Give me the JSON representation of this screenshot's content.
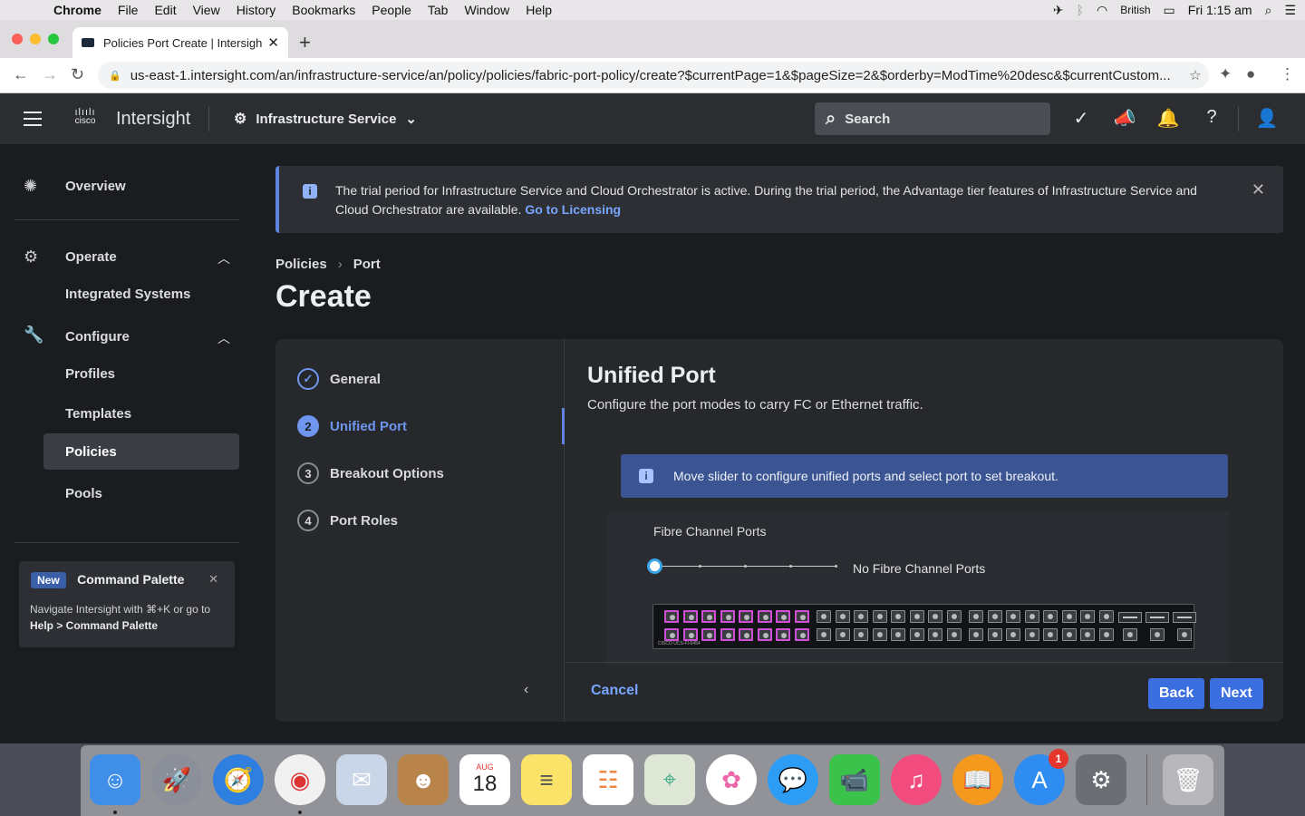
{
  "macos_menubar": {
    "app": "Chrome",
    "items": [
      "File",
      "Edit",
      "View",
      "History",
      "Bookmarks",
      "People",
      "Tab",
      "Window",
      "Help"
    ],
    "input_source": "British",
    "clock": "Fri 1:15 am"
  },
  "browser": {
    "tab_title": "Policies Port Create | Intersight",
    "url": "us-east-1.intersight.com/an/infrastructure-service/an/policy/policies/fabric-port-policy/create?$currentPage=1&$pageSize=2&$orderby=ModTime%20desc&$currentCustom..."
  },
  "header": {
    "brand_small": "cisco",
    "brand": "Intersight",
    "service": "Infrastructure Service",
    "search_placeholder": "Search"
  },
  "sidebar": {
    "overview": "Overview",
    "operate": "Operate",
    "integrated_systems": "Integrated Systems",
    "configure": "Configure",
    "profiles": "Profiles",
    "templates": "Templates",
    "policies": "Policies",
    "pools": "Pools",
    "palette": {
      "badge": "New",
      "title": "Command Palette",
      "desc_prefix": "Navigate Intersight with ⌘+K or go to ",
      "desc_link": "Help > Command Palette"
    }
  },
  "banner": {
    "text": "The trial period for Infrastructure Service and Cloud Orchestrator is active. During the trial period, the Advantage tier features of Infrastructure Service and Cloud Orchestrator are available.",
    "link": "Go to Licensing"
  },
  "breadcrumb": {
    "first": "Policies",
    "second": "Port"
  },
  "page_title": "Create",
  "wizard": {
    "steps": [
      {
        "num": "✓",
        "label": "General",
        "state": "done"
      },
      {
        "num": "2",
        "label": "Unified Port",
        "state": "active"
      },
      {
        "num": "3",
        "label": "Breakout Options",
        "state": "pending"
      },
      {
        "num": "4",
        "label": "Port Roles",
        "state": "pending"
      }
    ],
    "panel_title": "Unified Port",
    "panel_subtitle": "Configure the port modes to carry FC or Ethernet traffic.",
    "notice": "Move slider to configure unified ports and select port to set breakout.",
    "fc_label": "Fibre Channel Ports",
    "fc_value": "No Fibre Channel Ports",
    "slider_position": 0,
    "switch_model": "CISCO UCS-FI-6454",
    "cancel": "Cancel",
    "back": "Back",
    "next": "Next"
  },
  "dock": {
    "calendar_month": "AUG",
    "calendar_day": "18",
    "appstore_badge": "1"
  },
  "colors": {
    "accent": "#5f85e0",
    "link": "#78a6ff",
    "fc_port_highlight": "#d14fd6"
  }
}
